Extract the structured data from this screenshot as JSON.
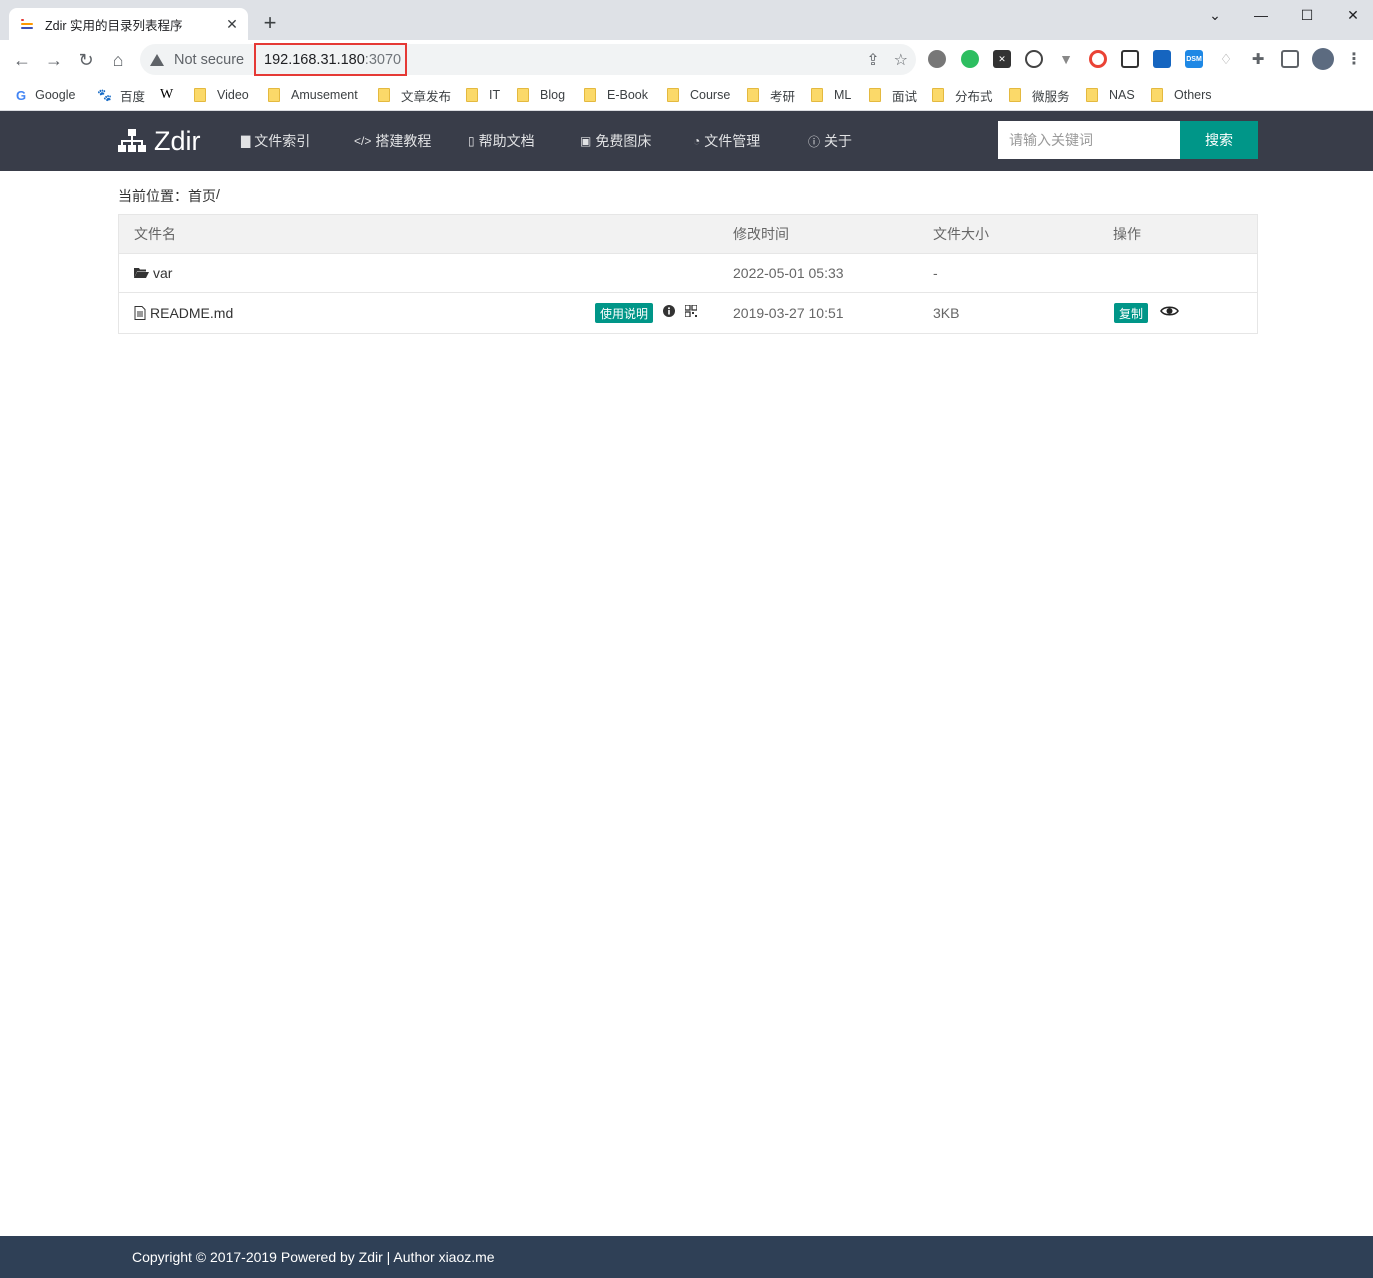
{
  "browser": {
    "tab_title": "Zdir 实用的目录列表程序",
    "security_label": "Not secure",
    "url_host": "192.168.31.180",
    "url_port": ":3070"
  },
  "bookmarks": [
    {
      "label": "Google",
      "icon": "google-icon"
    },
    {
      "label": "百度",
      "icon": "baidu-icon"
    },
    {
      "label": "",
      "icon": "wikipedia-icon"
    },
    {
      "label": "Video",
      "icon": "folder-icon"
    },
    {
      "label": "Amusement",
      "icon": "folder-icon"
    },
    {
      "label": "文章发布",
      "icon": "folder-icon"
    },
    {
      "label": "IT",
      "icon": "folder-icon"
    },
    {
      "label": "Blog",
      "icon": "folder-icon"
    },
    {
      "label": "E-Book",
      "icon": "folder-icon"
    },
    {
      "label": "Course",
      "icon": "folder-icon"
    },
    {
      "label": "考研",
      "icon": "folder-icon"
    },
    {
      "label": "ML",
      "icon": "folder-icon"
    },
    {
      "label": "面试",
      "icon": "folder-icon"
    },
    {
      "label": "分布式",
      "icon": "folder-icon"
    },
    {
      "label": "微服务",
      "icon": "folder-icon"
    },
    {
      "label": "NAS",
      "icon": "folder-icon"
    },
    {
      "label": "Others",
      "icon": "folder-icon"
    }
  ],
  "site": {
    "logo_text": "Zdir",
    "nav": [
      {
        "label": "文件索引",
        "icon": "file-icon"
      },
      {
        "label": "搭建教程",
        "icon": "code-icon"
      },
      {
        "label": "帮助文档",
        "icon": "doc-icon"
      },
      {
        "label": "免费图床",
        "icon": "image-icon"
      },
      {
        "label": "文件管理",
        "icon": "dashboard-icon"
      },
      {
        "label": "关于",
        "icon": "info-icon"
      }
    ],
    "search_placeholder": "请输入关键词",
    "search_button": "搜索"
  },
  "breadcrumb": {
    "prefix": "当前位置：",
    "home": "首页",
    "sep": " /"
  },
  "table": {
    "headers": {
      "name": "文件名",
      "time": "修改时间",
      "size": "文件大小",
      "op": "操作"
    },
    "rows": [
      {
        "name": "var",
        "time": "2022-05-01 05:33",
        "size": "-",
        "type": "folder"
      },
      {
        "name": "README.md",
        "time": "2019-03-27 10:51",
        "size": "3KB",
        "type": "file",
        "badge": "使用说明",
        "copy": "复制"
      }
    ]
  },
  "footer": {
    "text": "Copyright © 2017-2019 Powered by Zdir | Author xiaoz.me"
  },
  "colors": {
    "navbar": "#393d49",
    "accent": "#009688",
    "footer": "#2f4056",
    "url_highlight": "#e53935"
  }
}
